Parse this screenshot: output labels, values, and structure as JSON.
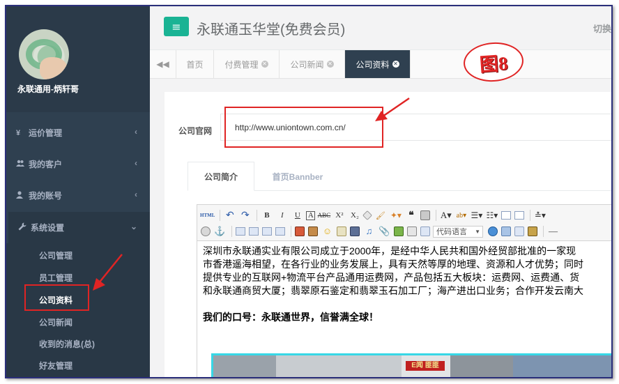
{
  "sidebar": {
    "profile_name": "永联通用-炳轩哥",
    "nav": [
      {
        "label": "运价管理",
        "icon": "yen-icon",
        "glyph": "¥"
      },
      {
        "label": "我的客户",
        "icon": "users-icon",
        "glyph": "👥"
      },
      {
        "label": "我的账号",
        "icon": "user-icon",
        "glyph": "👤"
      },
      {
        "label": "系统设置",
        "icon": "wrench-icon",
        "glyph": "🔧"
      }
    ],
    "sub_items": [
      "公司管理",
      "员工管理",
      "公司资料",
      "公司新闻",
      "收到的消息(总)",
      "好友管理"
    ]
  },
  "header": {
    "title": "永联通玉华堂(免费会员)",
    "switch_label": "切换"
  },
  "badge": {
    "label": "图8"
  },
  "tabs": [
    {
      "label": "首页",
      "closable": false
    },
    {
      "label": "付费管理",
      "closable": true
    },
    {
      "label": "公司新闻",
      "closable": true
    },
    {
      "label": "公司资料",
      "closable": true,
      "active": true
    }
  ],
  "form": {
    "website_label": "公司官网",
    "website_value": "http://www.uniontown.com.cn/"
  },
  "inner_tabs": [
    "公司简介",
    "首页Bannber"
  ],
  "editor": {
    "code_language_label": "代码语言",
    "paragraph_lines": [
      "深圳市永联通实业有限公司成立于2000年，是经中华人民共和国外经贸部批准的一家现",
      "市香港遥海相望，在各行业的业务发展上，具有天然等厚的地理、资源和人才优势；同时",
      "提供专业的互联网+物流平台产品通用运费网，产品包括五大板块：运费网、运费通、货",
      "和永联通商贸大厦；翡翠原石鉴定和翡翠玉石加工厂；海产进出口业务；合作开发云南大"
    ],
    "slogan": "我们的口号：永联通世界，信誉满全球！",
    "photo_sign_text": "E闻 匪匪"
  },
  "colors": {
    "sidebar_bg": "#2f4050",
    "accent_green": "#1ab394",
    "highlight_red": "#e02424",
    "photo_border": "#37d7e6"
  }
}
